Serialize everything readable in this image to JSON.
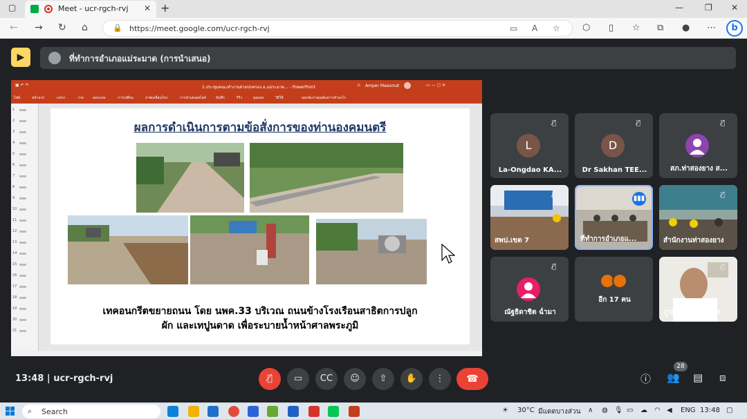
{
  "browser": {
    "tab_title": "Meet - ucr-rgch-rvj",
    "tab_close": "✕",
    "new_tab": "+",
    "url": "https://meet.google.com/ucr-rgch-rvj"
  },
  "meet": {
    "banner_text": "ที่ทำการอำเภอแม่ระมาด (การนำเสนอ)",
    "clock": "13:48",
    "meeting_code": "ucr-rgch-rvj",
    "participant_count_badge": "28"
  },
  "powerpoint": {
    "title": "1.ประชุมคณะทำงานฝ่ายปกครอง อ.แม่ระมาด... - PowerPoint",
    "user": "Amper Maesmat",
    "ribbon_tabs": [
      "ไฟล์",
      "หน้าแรก",
      "แทรก",
      "วาด",
      "ออกแบบ",
      "การเปลี่ยน",
      "ภาพเคลื่อนไหว",
      "การนำเสนอสไลด์",
      "บันทึก",
      "รีวิว",
      "มุมมอง",
      "วิธีใช้",
      "บอกฉันว่าคุณต้องการทำอะไร"
    ],
    "slide": {
      "heading": "ผลการดำเนินการตามข้อสั่งการของท่านองคมนตรี",
      "caption_line1": "เทคอนกรีตขยายถนน โดย นพค.33 บริเวณ ถนนข้างโรงเรือนสาธิตการปลูก",
      "caption_line2": "ผัก และเทปูนดาด เพื่อระบายน้ำหน้าศาลพระภูมิ"
    }
  },
  "participants": [
    {
      "initial": "L",
      "name": "La-Ongdao KA...",
      "avatar_color": "#795548"
    },
    {
      "initial": "D",
      "name": "Dr Sakhan TEE...",
      "avatar_color": "#795548"
    },
    {
      "initial": "",
      "name": "สภ.ท่าสองยาง ส...",
      "avatar_color": "#8e44ad"
    },
    {
      "name": "สพป.เขต 7"
    },
    {
      "name": "ที่ทำการอำเภอแ..."
    },
    {
      "name": "สำนักงานท่าสองยาง"
    },
    {
      "initial": "",
      "name": "ณัฐธิดาชิต ฉ่ำมา",
      "avatar_color": "#e91e63"
    },
    {
      "name": "อีก 17 คน"
    },
    {
      "name": "ภูวดิท ภถมมณีไซต"
    }
  ],
  "taskbar": {
    "search_label": "Search",
    "temperature": "30°C",
    "weather_text": "มีแดดบางส่วน",
    "lang": "ENG",
    "time": "13:48"
  },
  "colors": {
    "meet_bg": "#202124",
    "tile_bg": "#3c4043",
    "end_call": "#ea4335",
    "ppt_red": "#c43e1c",
    "presenting_yellow": "#fdd663"
  }
}
